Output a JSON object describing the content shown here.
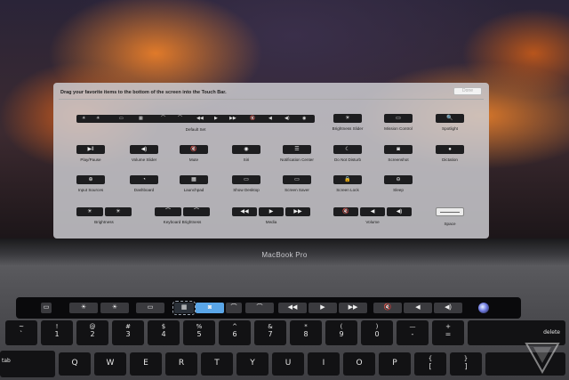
{
  "screen": {
    "panel_title": "Drag your favorite items to the bottom of the screen into the Touch Bar.",
    "done_label": "Done",
    "default_set": {
      "label": "Default Set",
      "glyphs": [
        "☀",
        "☀",
        "▭",
        "▦",
        "⌒",
        "⌒",
        "◀◀",
        "▶",
        "▶▶",
        "🔇",
        "◀",
        "◀)",
        "◉"
      ]
    },
    "items": {
      "brightness_slider": {
        "label": "Brightness Slider",
        "icon": "☀"
      },
      "mission_control": {
        "label": "Mission Control",
        "icon": "▭"
      },
      "spotlight": {
        "label": "Spotlight",
        "icon": "🔍"
      },
      "play_pause": {
        "label": "Play/Pause",
        "icon": "▶‖"
      },
      "volume_slider": {
        "label": "Volume Slider",
        "icon": "◀)"
      },
      "mute": {
        "label": "Mute",
        "icon": "🔇"
      },
      "siri": {
        "label": "Siri",
        "icon": "◉"
      },
      "notification_center": {
        "label": "Notification Center",
        "icon": "☰"
      },
      "do_not_disturb": {
        "label": "Do Not Disturb",
        "icon": "☾"
      },
      "screenshot": {
        "label": "Screenshot",
        "icon": "◙"
      },
      "dictation": {
        "label": "Dictation",
        "icon": "●"
      },
      "input_sources": {
        "label": "Input Sources",
        "icon": "⊕"
      },
      "dashboard": {
        "label": "Dashboard",
        "icon": "◔"
      },
      "launchpad": {
        "label": "Launchpad",
        "icon": "▦"
      },
      "show_desktop": {
        "label": "Show Desktop",
        "icon": "▭"
      },
      "screen_saver": {
        "label": "Screen Saver",
        "icon": "▭"
      },
      "screen_lock": {
        "label": "Screen Lock",
        "icon": "🔒"
      },
      "sleep": {
        "label": "Sleep",
        "icon": "⊖"
      },
      "brightness": {
        "label": "Brightness",
        "icons": [
          "☀",
          "☀"
        ]
      },
      "keyboard_brightness": {
        "label": "Keyboard Brightness",
        "icons": [
          "⌒",
          "⌒"
        ]
      },
      "media": {
        "label": "Media",
        "icons": [
          "◀◀",
          "▶",
          "▶▶"
        ]
      },
      "volume": {
        "label": "Volume",
        "icons": [
          "🔇",
          "◀",
          "◀)"
        ]
      },
      "space": {
        "label": "Space"
      }
    }
  },
  "laptop": {
    "brand": "MacBook Pro"
  },
  "touchbar": {
    "glyphs": [
      "▭",
      "☀",
      "☀",
      "▭",
      "▦",
      "◙",
      "⌒",
      "⌒",
      "◀◀",
      "▶",
      "▶▶",
      "🔇",
      "◀",
      "◀)",
      "◉"
    ]
  },
  "keyboard": {
    "number_row": [
      {
        "top": "~",
        "bot": "`"
      },
      {
        "top": "!",
        "bot": "1"
      },
      {
        "top": "@",
        "bot": "2"
      },
      {
        "top": "#",
        "bot": "3"
      },
      {
        "top": "$",
        "bot": "4"
      },
      {
        "top": "%",
        "bot": "5"
      },
      {
        "top": "^",
        "bot": "6"
      },
      {
        "top": "&",
        "bot": "7"
      },
      {
        "top": "*",
        "bot": "8"
      },
      {
        "top": "(",
        "bot": "9"
      },
      {
        "top": ")",
        "bot": "0"
      },
      {
        "top": "—",
        "bot": "-"
      },
      {
        "top": "+",
        "bot": "="
      }
    ],
    "delete_label": "delete",
    "tab_label": "tab",
    "qwerty_row": [
      "Q",
      "W",
      "E",
      "R",
      "T",
      "Y",
      "U",
      "I",
      "O",
      "P"
    ],
    "bracket_keys": [
      {
        "top": "{",
        "bot": "["
      },
      {
        "top": "}",
        "bot": "]"
      }
    ]
  },
  "colors": {
    "touchbar_selected": "#5aa6e8",
    "panel_bg": "#cdcdd2"
  }
}
